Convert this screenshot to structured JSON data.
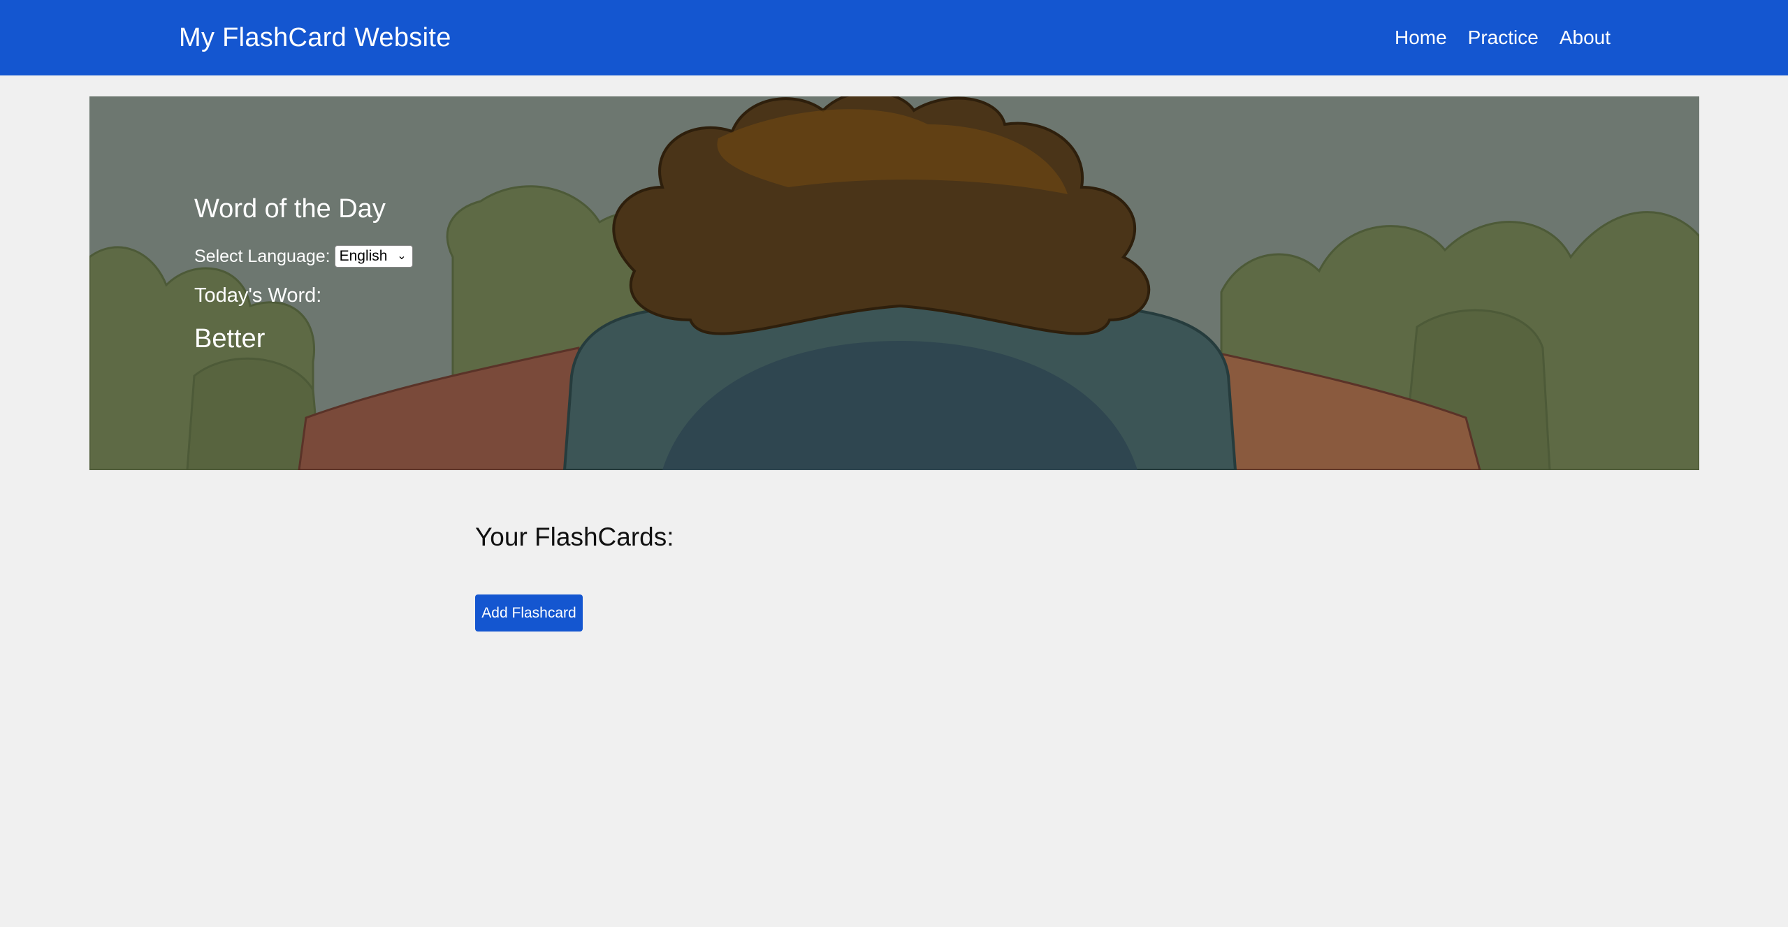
{
  "navbar": {
    "brand": "My FlashCard Website",
    "links": [
      "Home",
      "Practice",
      "About"
    ],
    "color": "#1456d0"
  },
  "hero": {
    "title": "Word of the Day",
    "language_label": "Select Language:",
    "language_selected": "English",
    "today_label": "Today's Word:",
    "word": "Better",
    "image_icon": "cartoon-person-back-illustration"
  },
  "flashcards": {
    "title": "Your FlashCards:",
    "add_button": "Add Flashcard"
  }
}
